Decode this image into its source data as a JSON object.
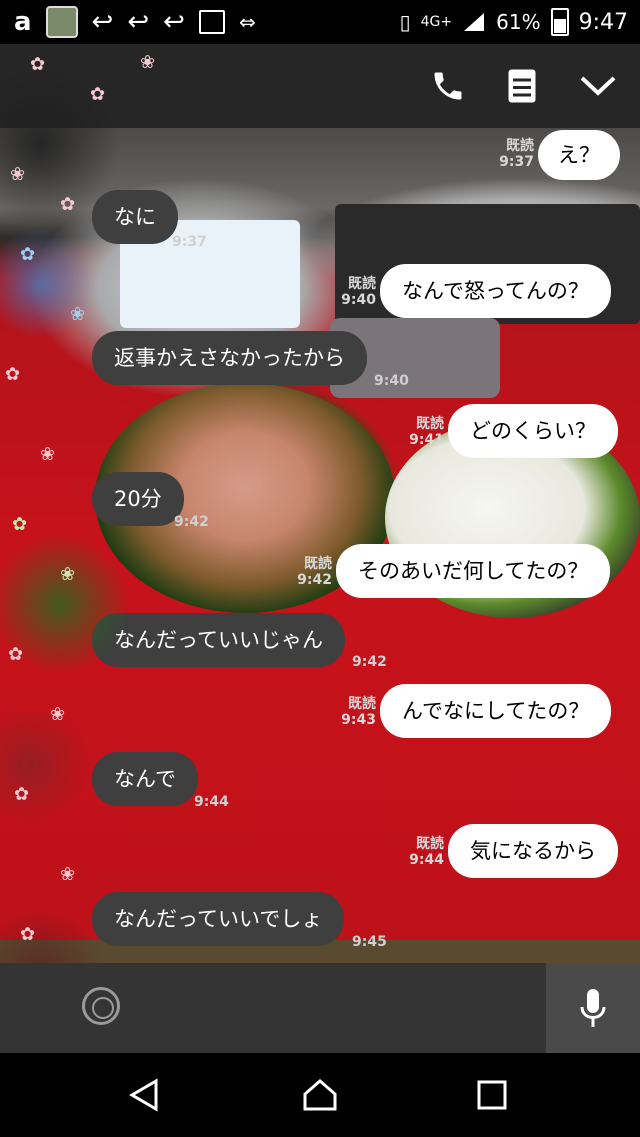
{
  "status_bar": {
    "notification_icons": [
      "app-a-icon",
      "app-avatar-icon",
      "reply-icon",
      "reply-icon",
      "reply-icon",
      "image-icon",
      "data-saver-icon"
    ],
    "network": "4G+",
    "battery": "61%",
    "time": "9:47"
  },
  "header": {
    "title": "",
    "buttons": [
      "phone-icon",
      "notes-icon",
      "chevron-down-icon"
    ]
  },
  "messages": [
    {
      "side": "out",
      "text": "え？",
      "read": "既読",
      "time": "9:37"
    },
    {
      "side": "in",
      "text": "なに",
      "time": "9:37"
    },
    {
      "side": "out",
      "text": "なんで怒ってんの？",
      "read": "既読",
      "time": "9:40"
    },
    {
      "side": "in",
      "text": "返事かえさなかったから",
      "time": "9:40"
    },
    {
      "side": "out",
      "text": "どのくらい？",
      "read": "既読",
      "time": "9:41"
    },
    {
      "side": "in",
      "text": "20分",
      "time": "9:42"
    },
    {
      "side": "out",
      "text": "そのあいだ何してたの？",
      "read": "既読",
      "time": "9:42"
    },
    {
      "side": "in",
      "text": "なんだっていいじゃん",
      "time": "9:42"
    },
    {
      "side": "out",
      "text": "んでなにしてたの？",
      "read": "既読",
      "time": "9:43"
    },
    {
      "side": "in",
      "text": "なんで",
      "time": "9:44"
    },
    {
      "side": "out",
      "text": "気になるから",
      "read": "既読",
      "time": "9:44"
    },
    {
      "side": "in",
      "text": "なんだっていいでしょ",
      "time": "9:45"
    }
  ],
  "input_bar": {
    "emoji_button": "emoji-icon",
    "mic_button": "microphone-icon"
  },
  "nav_bar": {
    "buttons": [
      "back-icon",
      "home-icon",
      "recents-icon"
    ]
  },
  "colors": {
    "incoming_bubble": "#3f3f3f",
    "outgoing_bubble": "#ffffff",
    "header_bg": "#262626"
  }
}
